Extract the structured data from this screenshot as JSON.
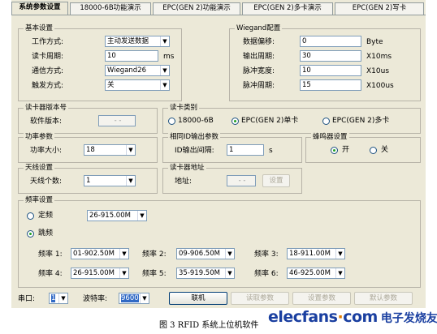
{
  "tabs": [
    "系统参数设置",
    "18000-6B功能演示",
    "EPC(GEN 2)功能演示",
    "EPC(GEN 2)多卡演示",
    "EPC(GEN 2)写卡"
  ],
  "basic": {
    "title": "基本设置",
    "work_mode_label": "工作方式:",
    "work_mode": "主动发送数据",
    "read_period_label": "读卡周期:",
    "read_period": "10",
    "read_period_unit": "ms",
    "comm_label": "通信方式:",
    "comm": "Wiegand26",
    "trigger_label": "触发方式:",
    "trigger": "关"
  },
  "wiegand": {
    "title": "Wiegand配置",
    "offset_label": "数据偏移:",
    "offset": "0",
    "offset_unit": "Byte",
    "out_period_label": "输出周期:",
    "out_period": "30",
    "out_period_unit": "X10ms",
    "pulse_width_label": "脉冲宽度:",
    "pulse_width": "10",
    "pulse_width_unit": "X10us",
    "pulse_period_label": "脉冲周期:",
    "pulse_period": "15",
    "pulse_period_unit": "X100us"
  },
  "version": {
    "title": "读卡器版本号",
    "label": "软件版本:",
    "value": "- -"
  },
  "card_type": {
    "title": "读卡类别",
    "opt1": "18000-6B",
    "opt2": "EPC(GEN 2)单卡",
    "opt3": "EPC(GEN 2)多卡"
  },
  "power": {
    "title": "功率参数",
    "label": "功率大小:",
    "value": "18"
  },
  "same_id": {
    "title": "相同ID输出参数",
    "label": "ID输出间隔:",
    "value": "1",
    "unit": "s"
  },
  "buzzer": {
    "title": "蜂鸣器设置",
    "on": "开",
    "off": "关"
  },
  "antenna": {
    "title": "天线设置",
    "label": "天线个数:",
    "value": "1"
  },
  "address": {
    "title": "读卡器地址",
    "label": "地址:",
    "value": "- -",
    "button": "设置"
  },
  "freq": {
    "title": "频率设置",
    "fixed_label": "定频",
    "fixed_value": "26-915.00M",
    "hop_label": "跳频",
    "items": [
      {
        "label": "频率 1:",
        "value": "01-902.50M"
      },
      {
        "label": "频率 2:",
        "value": "09-906.50M"
      },
      {
        "label": "频率 3:",
        "value": "18-911.00M"
      },
      {
        "label": "频率 4:",
        "value": "26-915.00M"
      },
      {
        "label": "频率 5:",
        "value": "35-919.50M"
      },
      {
        "label": "频率 6:",
        "value": "46-925.00M"
      }
    ]
  },
  "bottom": {
    "port_label": "串口:",
    "port": "1",
    "baud_label": "波特率:",
    "baud": "9600",
    "connect": "联机",
    "read_params": "读取参数",
    "set_params": "设置参数",
    "default_params": "默认参数"
  },
  "caption": "图 3 RFID 系统上位机软件",
  "logo": {
    "site": "elecfans",
    "dot": "·",
    "tld": "com",
    "cn": "电子发烧友"
  }
}
